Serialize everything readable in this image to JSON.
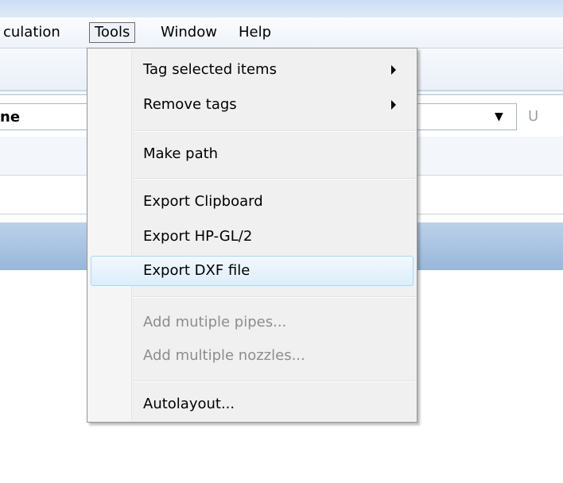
{
  "menubar": {
    "items": [
      {
        "label": "culation"
      },
      {
        "label": "Tools"
      },
      {
        "label": "Window"
      },
      {
        "label": "Help"
      }
    ]
  },
  "combo": {
    "value": "ne"
  },
  "disabled_button": {
    "label": "U"
  },
  "tools_menu": {
    "items": [
      {
        "label": "Tag selected items",
        "submenu": true,
        "enabled": true
      },
      {
        "label": "Remove tags",
        "submenu": true,
        "enabled": true
      },
      {
        "label": "Make path",
        "enabled": true
      },
      {
        "label": "Export Clipboard",
        "enabled": true
      },
      {
        "label": "Export HP-GL/2",
        "enabled": true
      },
      {
        "label": "Export DXF file",
        "enabled": true,
        "highlighted": true
      },
      {
        "label": "Add mutiple pipes...",
        "enabled": false
      },
      {
        "label": "Add multiple nozzles...",
        "enabled": false
      },
      {
        "label": "Autolayout...",
        "enabled": true
      }
    ]
  }
}
